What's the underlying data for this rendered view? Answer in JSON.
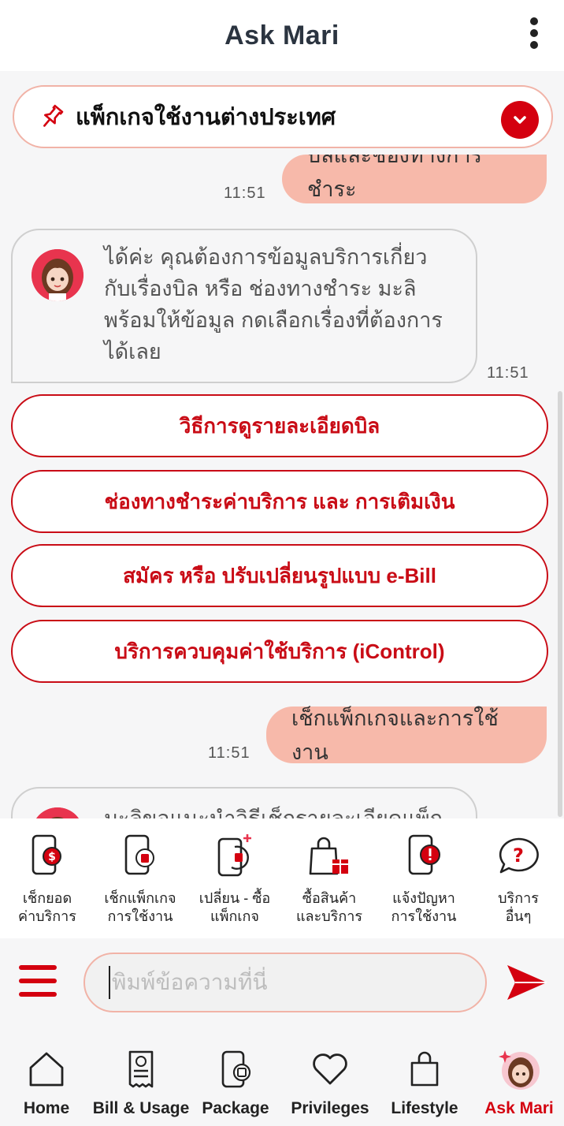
{
  "header": {
    "title": "Ask Mari"
  },
  "pinned": {
    "text": "แพ็กเกจใช้งานต่างประเทศ"
  },
  "chat": {
    "user_msg_1": {
      "text": "บิลและช่องทางการชำระ",
      "time": "11:51"
    },
    "bot_msg_1": {
      "lines": [
        "ได้ค่ะ คุณต้องการข้อมูลบริการเกี่ยว",
        "กับเรื่องบิล หรือ ช่องทางชำระ มะลิ",
        "พร้อมให้ข้อมูล กดเลือกเรื่องที่ต้องการ",
        "ได้เลย"
      ],
      "time": "11:51"
    },
    "quick_replies": [
      "วิธีการดูรายละเอียดบิล",
      "ช่องทางชำระค่าบริการ และ การเติมเงิน",
      "สมัคร หรือ ปรับเปลี่ยนรูปแบบ e-Bill",
      "บริการควบคุมค่าใช้บริการ (iControl)"
    ],
    "user_msg_2": {
      "text": "เช็กแพ็กเกจและการใช้งาน",
      "time": "11:51"
    },
    "bot_msg_2": {
      "text": "มะลิขอแนะนำวิธีเช็กรายละเอียดแพ็ก"
    }
  },
  "shortcuts": [
    {
      "icon": "phone-bill-icon",
      "line1": "เช็กยอด",
      "line2": "ค่าบริการ"
    },
    {
      "icon": "phone-package-icon",
      "line1": "เช็กแพ็กเกจ",
      "line2": "การใช้งาน"
    },
    {
      "icon": "phone-swap-icon",
      "line1": "เปลี่ยน - ซื้อ",
      "line2": "แพ็กเกจ"
    },
    {
      "icon": "shopping-bag-gift-icon",
      "line1": "ซื้อสินค้า",
      "line2": "และบริการ"
    },
    {
      "icon": "phone-alert-icon",
      "line1": "แจ้งปัญหา",
      "line2": "การใช้งาน"
    },
    {
      "icon": "question-bubble-icon",
      "line1": "บริการ",
      "line2": "อื่นๆ"
    }
  ],
  "input": {
    "placeholder": "พิมพ์ข้อความที่นี่"
  },
  "tabs": [
    {
      "label": "Home",
      "icon": "home-icon"
    },
    {
      "label": "Bill & Usage",
      "icon": "receipt-icon"
    },
    {
      "label": "Package",
      "icon": "phone-package-icon"
    },
    {
      "label": "Privileges",
      "icon": "heart-icon"
    },
    {
      "label": "Lifestyle",
      "icon": "shopping-bag-icon"
    },
    {
      "label": "Ask Mari",
      "icon": "mari-avatar-icon",
      "active": true
    }
  ],
  "colors": {
    "brand_red": "#d4000f",
    "user_bubble": "#f7b9aa",
    "border_pink": "#f1b3a7"
  }
}
